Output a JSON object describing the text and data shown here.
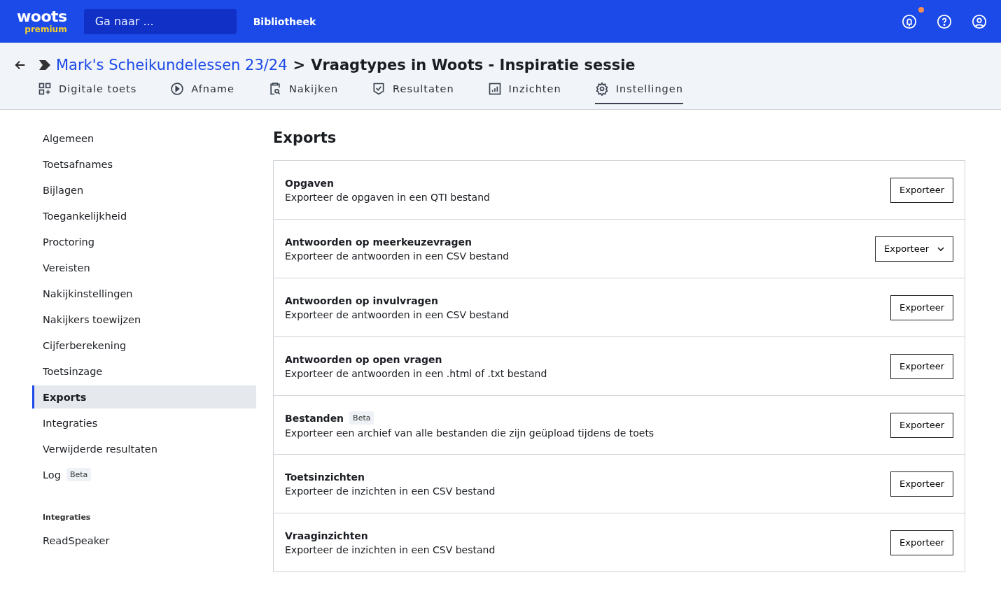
{
  "topbar": {
    "logo": "woots",
    "logo_sub": "premium",
    "search": {
      "placeholder": "Ga naar ..."
    },
    "nav_link": "Bibliotheek",
    "notification": true
  },
  "breadcrumb": {
    "parent": "Mark's Scheikundelessen 23/24",
    "separator": ">",
    "current": "Vraagtypes in Woots - Inspiratie sessie"
  },
  "tabs": [
    {
      "label": "Digitale toets",
      "kind": "grid",
      "selected": false
    },
    {
      "label": "Afname",
      "kind": "play",
      "selected": false
    },
    {
      "label": "Nakijken",
      "kind": "clipboard",
      "selected": false
    },
    {
      "label": "Resultaten",
      "kind": "shield",
      "selected": false
    },
    {
      "label": "Inzichten",
      "kind": "chart",
      "selected": false
    },
    {
      "label": "Instellingen",
      "kind": "gear",
      "selected": true
    }
  ],
  "sidebar": {
    "items": [
      {
        "label": "Algemeen",
        "selected": false
      },
      {
        "label": "Toetsafnames",
        "selected": false
      },
      {
        "label": "Bijlagen",
        "selected": false
      },
      {
        "label": "Toegankelijkheid",
        "selected": false
      },
      {
        "label": "Proctoring",
        "selected": false
      },
      {
        "label": "Vereisten",
        "selected": false
      },
      {
        "label": "Nakijkinstellingen",
        "selected": false
      },
      {
        "label": "Nakijkers toewijzen",
        "selected": false
      },
      {
        "label": "Cijferberekening",
        "selected": false
      },
      {
        "label": "Toetsinzage",
        "selected": false
      },
      {
        "label": "Exports",
        "selected": true
      },
      {
        "label": "Integraties",
        "selected": false
      },
      {
        "label": "Verwijderde resultaten",
        "selected": false
      },
      {
        "label": "Log",
        "badge": "Beta",
        "selected": false
      }
    ],
    "section_title": "Integraties",
    "section_items": [
      {
        "label": "ReadSpeaker",
        "selected": false
      }
    ]
  },
  "page_title": "Exports",
  "exports": [
    {
      "title": "Opgaven",
      "description": "Exporteer de opgaven in een QTI bestand",
      "button": "Exporteer",
      "kind": "plain"
    },
    {
      "title": "Antwoorden op meerkeuzevragen",
      "description": "Exporteer de antwoorden in een CSV bestand",
      "button": "Exporteer",
      "kind": "dropdown"
    },
    {
      "title": "Antwoorden op invulvragen",
      "description": "Exporteer de antwoorden in een CSV bestand",
      "button": "Exporteer",
      "kind": "plain"
    },
    {
      "title": "Antwoorden op open vragen",
      "description": "Exporteer de antwoorden in een .html of .txt bestand",
      "button": "Exporteer",
      "kind": "plain"
    },
    {
      "title": "Bestanden",
      "badge": "Beta",
      "description": "Exporteer een archief van alle bestanden die zijn geüpload tijdens de toets",
      "button": "Exporteer",
      "kind": "plain"
    },
    {
      "title": "Toetsinzichten",
      "description": "Exporteer de inzichten in een CSV bestand",
      "button": "Exporteer",
      "kind": "plain"
    },
    {
      "title": "Vraaginzichten",
      "description": "Exporteer de inzichten in een CSV bestand",
      "button": "Exporteer",
      "kind": "plain"
    }
  ]
}
